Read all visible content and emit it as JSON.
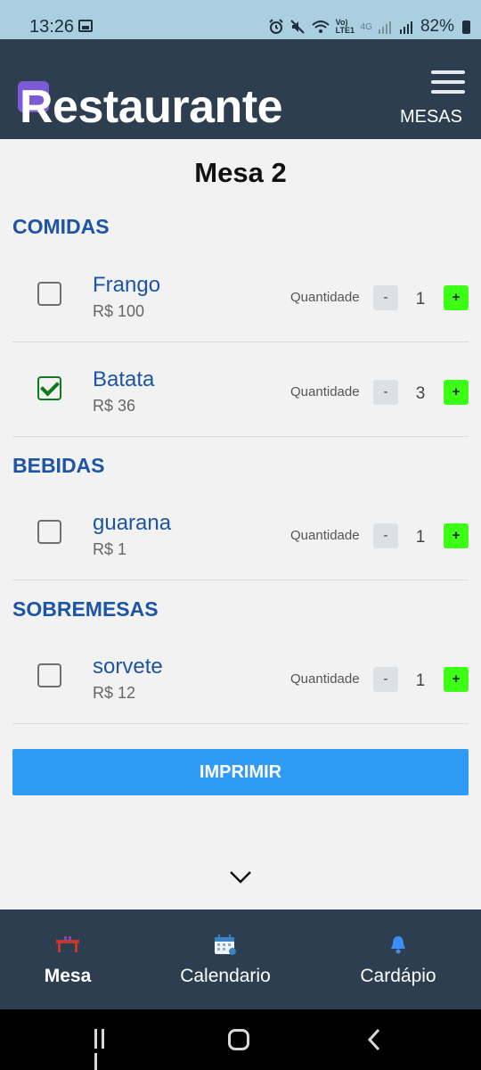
{
  "status_bar": {
    "time": "13:26",
    "battery_percent": "82%",
    "network_label": "Vo) LTE1",
    "signal_label": "4G"
  },
  "header": {
    "app_title": "Restaurante",
    "nav_link": "MESAS"
  },
  "main": {
    "page_title": "Mesa 2",
    "quantity_label": "Quantidade",
    "minus_label": "-",
    "plus_label": "+",
    "sections": [
      {
        "title": "COMIDAS",
        "items": [
          {
            "name": "Frango",
            "price": "R$ 100",
            "quantity": "1",
            "checked": false
          },
          {
            "name": "Batata",
            "price": "R$ 36",
            "quantity": "3",
            "checked": true
          }
        ]
      },
      {
        "title": "BEBIDAS",
        "items": [
          {
            "name": "guarana",
            "price": "R$ 1",
            "quantity": "1",
            "checked": false
          }
        ]
      },
      {
        "title": "SOBREMESAS",
        "items": [
          {
            "name": "sorvete",
            "price": "R$ 12",
            "quantity": "1",
            "checked": false
          }
        ]
      }
    ],
    "print_button": "IMPRIMIR"
  },
  "tab_bar": {
    "tabs": [
      {
        "label": "Mesa",
        "icon": "table-icon",
        "active": true
      },
      {
        "label": "Calendario",
        "icon": "calendar-icon",
        "active": false
      },
      {
        "label": "Cardápio",
        "icon": "bell-icon",
        "active": false
      }
    ]
  },
  "colors": {
    "header_bg": "#2c3e50",
    "section_title": "#1c54a6",
    "print_button": "#2f9bf5",
    "plus_button": "#3dff15",
    "logo_accent": "#7e5bd6",
    "check_green": "#0d7a1b"
  }
}
